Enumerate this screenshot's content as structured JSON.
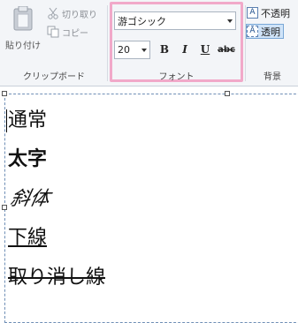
{
  "clipboard": {
    "paste_label": "貼り付け",
    "cut_label": "切り取り",
    "copy_label": "コピー",
    "group_label": "クリップボード"
  },
  "font": {
    "family": "游ゴシック",
    "size": "20",
    "bold_label": "B",
    "italic_label": "I",
    "underline_label": "U",
    "strike_label": "abc",
    "group_label": "フォント",
    "highlight_color": "#f1a9c9"
  },
  "background": {
    "opaque_label": "不透明",
    "transparent_label": "透明",
    "group_label": "背景",
    "selected": "透明"
  },
  "text_lines": {
    "normal": "通常",
    "bold": "太字",
    "italic": "斜体",
    "underline": "下線",
    "strike": "取り消し線"
  }
}
